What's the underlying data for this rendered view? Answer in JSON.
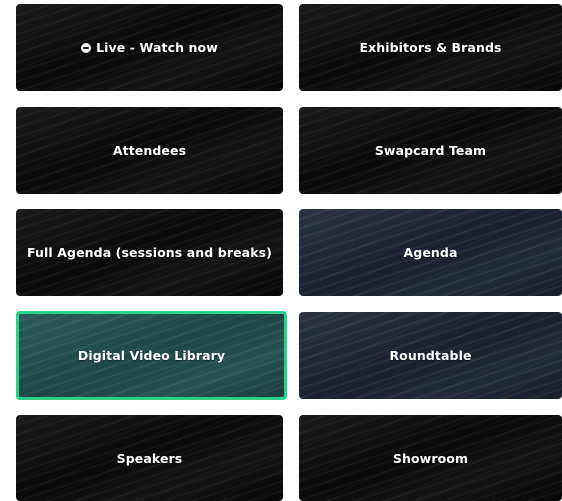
{
  "tiles": [
    {
      "label": "Live - Watch now",
      "icon": "live-icon",
      "style": "dark"
    },
    {
      "label": "Exhibitors & Brands",
      "style": "dark"
    },
    {
      "label": "Attendees",
      "style": "dark"
    },
    {
      "label": "Swapcard Team",
      "style": "dark"
    },
    {
      "label": "Full Agenda (sessions and breaks)",
      "style": "dark"
    },
    {
      "label": "Agenda",
      "style": "navy"
    },
    {
      "label": "Digital Video Library",
      "style": "teal",
      "selected": true
    },
    {
      "label": "Roundtable",
      "style": "navy"
    },
    {
      "label": "Speakers",
      "style": "dark"
    },
    {
      "label": "Showroom",
      "style": "dark"
    }
  ],
  "colors": {
    "selected_border": "#2bd18a",
    "tile_dark": "#0c0c0c",
    "tile_navy": "#1c2230",
    "tile_teal": "#1f4b48"
  }
}
